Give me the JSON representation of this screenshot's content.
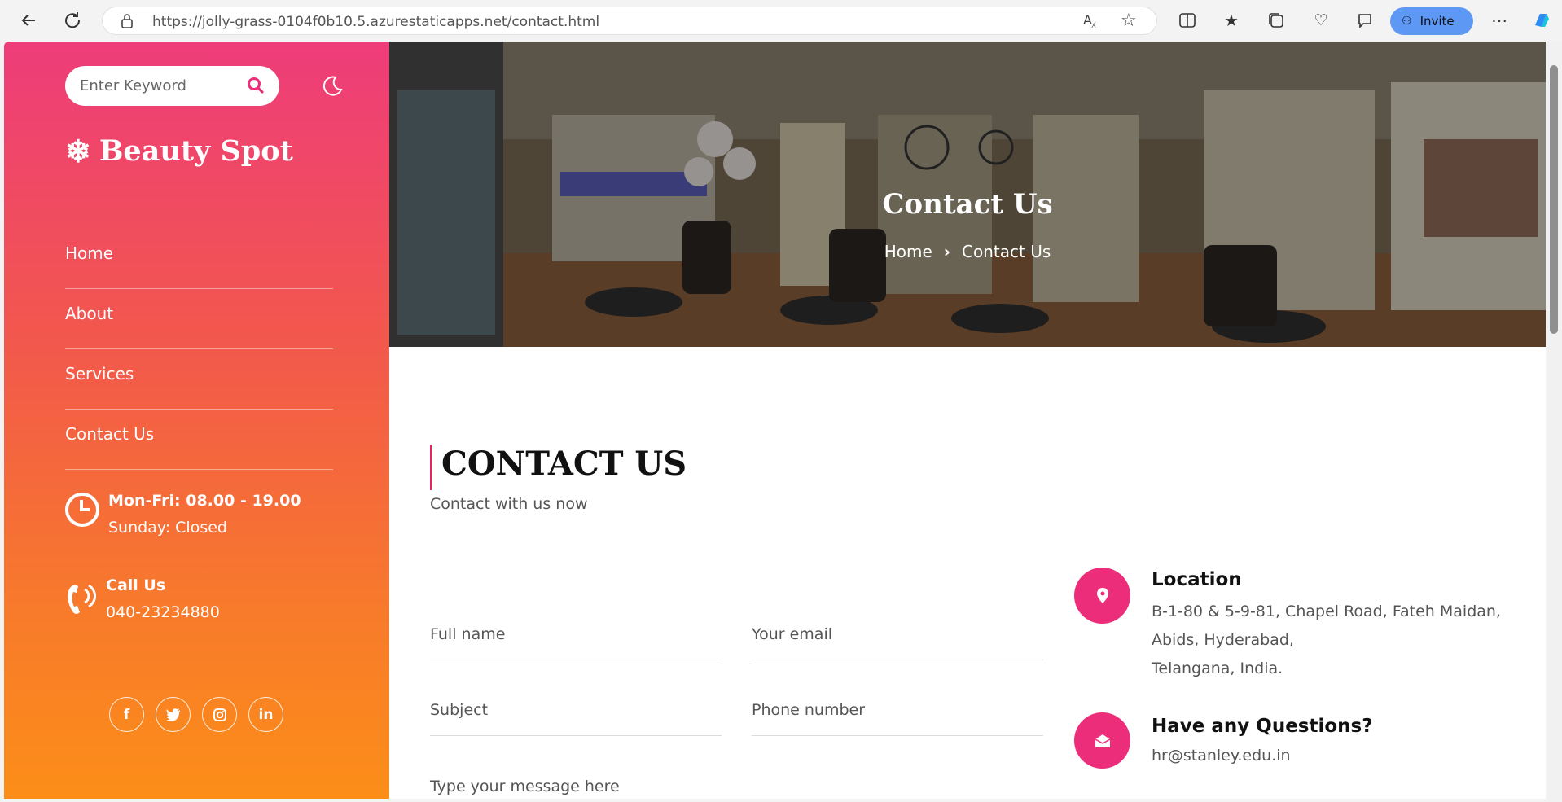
{
  "browser": {
    "url_host": "https://jolly-grass-0104f0b10.5.azurestaticapps.net",
    "url_path": "/contact.html",
    "invite_label": "Invite"
  },
  "sidebar": {
    "search_placeholder": "Enter Keyword",
    "brand": "Beauty Spot",
    "menu": [
      {
        "label": "Home"
      },
      {
        "label": "About"
      },
      {
        "label": "Services"
      },
      {
        "label": "Contact Us"
      }
    ],
    "hours_title": "Mon-Fri: 08.00 - 19.00",
    "hours_sub": "Sunday: Closed",
    "call_title": "Call Us",
    "call_number": "040-23234880",
    "socials": [
      "facebook-icon",
      "twitter-icon",
      "instagram-icon",
      "linkedin-icon"
    ]
  },
  "hero": {
    "title": "Contact Us",
    "crumb_home": "Home",
    "crumb_current": "Contact Us"
  },
  "contact": {
    "heading": "CONTACT US",
    "subheading": "Contact with us now",
    "fields": {
      "full_name": "Full name",
      "email": "Your email",
      "subject": "Subject",
      "phone": "Phone number",
      "message": "Type your message here"
    },
    "location_title": "Location",
    "location_lines": [
      "B-1-80 & 5-9-81, Chapel Road, Fateh Maidan,",
      "Abids, Hyderabad,",
      "Telangana, India."
    ],
    "questions_title": "Have any Questions?",
    "questions_email": "hr@stanley.edu.in"
  },
  "colors": {
    "accent": "#ec2d79",
    "sidebar_top": "#ee3c7a",
    "sidebar_bottom": "#fc8e18"
  }
}
